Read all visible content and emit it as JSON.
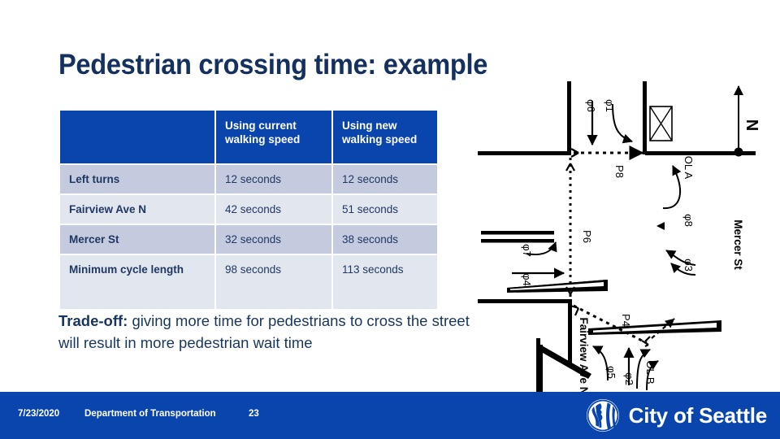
{
  "slide": {
    "title": "Pedestrian crossing time: example"
  },
  "table": {
    "headers": [
      "",
      "Using current walking speed",
      "Using new walking speed"
    ],
    "rows": [
      {
        "label": "Left turns",
        "current": "12 seconds",
        "new": "12 seconds"
      },
      {
        "label": "Fairview Ave N",
        "current": "42 seconds",
        "new": "51 seconds"
      },
      {
        "label": "Mercer St",
        "current": "32 seconds",
        "new": "38 seconds"
      },
      {
        "label": "Minimum cycle length",
        "current": "98 seconds",
        "new": "113 seconds"
      }
    ]
  },
  "tradeoff": {
    "lead": "Trade-off:",
    "body": " giving more time for pedestrians to cross the street will result in more pedestrian wait time"
  },
  "footer": {
    "date": "7/23/2020",
    "department": "Department of Transportation",
    "slide_number": "23",
    "logo_text": "City of Seattle",
    "logo_icon": "seattle-seal-icon"
  },
  "diagram": {
    "name": "intersection-phasing-diagram",
    "streets": [
      "Fairview Ave N",
      "Mercer St"
    ],
    "north_label": "N",
    "phase_labels": [
      "φ6",
      "φ1",
      "φ7",
      "φ4",
      "φ8",
      "φ3",
      "φ2",
      "φ5"
    ],
    "overlap_labels": [
      "OL A",
      "OL B"
    ],
    "ped_phase_labels": [
      "P8",
      "P6",
      "P4"
    ]
  },
  "colors": {
    "brand_blue": "#0A45AE",
    "title_navy": "#14305E",
    "row_dark": "#C5CBDE",
    "row_light": "#E2E6EF",
    "text_navy": "#1F3864"
  }
}
